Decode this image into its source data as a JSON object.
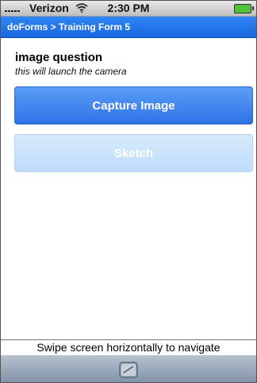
{
  "status_bar": {
    "carrier": "Verizon",
    "time": "2:30 PM",
    "signal_icon": "signal-bars-icon",
    "wifi_icon": "wifi-icon",
    "battery_icon": "battery-icon"
  },
  "nav": {
    "breadcrumb": "doForms > Training Form 5"
  },
  "question": {
    "title": "image question",
    "hint": "this will launch the camera"
  },
  "buttons": {
    "capture_label": "Capture Image",
    "sketch_label": "Sketch"
  },
  "footer": {
    "swipe_hint": "Swipe screen horizontally to navigate",
    "toolbar_icon": "edit-note-icon"
  },
  "colors": {
    "nav_blue": "#1f74ea",
    "capture_blue": "#3b82ef",
    "sketch_light_blue": "#c9e3fc",
    "toolbar_gray": "#8e9db0"
  }
}
